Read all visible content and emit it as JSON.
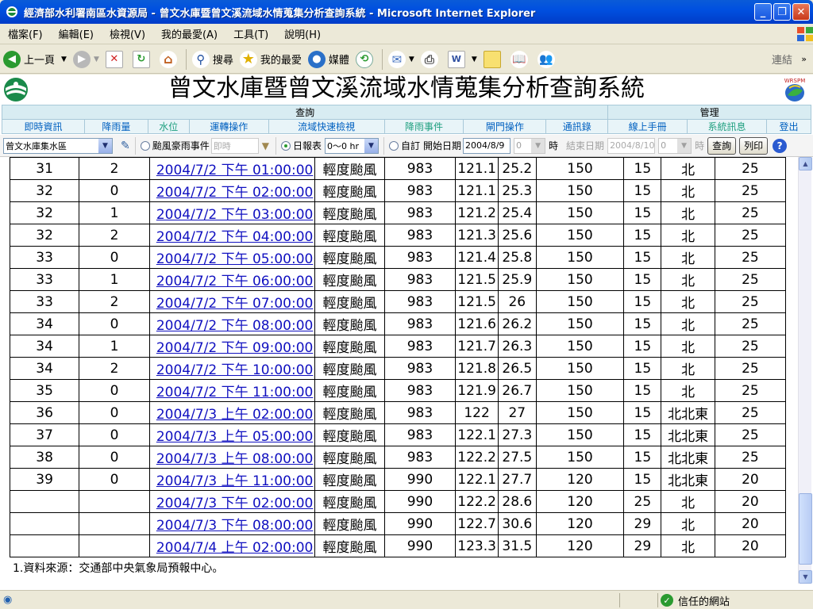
{
  "window": {
    "title": "經濟部水利署南區水資源局 - 曾文水庫暨曾文溪流域水情蒐集分析查詢系統 - Microsoft Internet Explorer"
  },
  "menu": [
    "檔案(F)",
    "編輯(E)",
    "檢視(V)",
    "我的最愛(A)",
    "工具(T)",
    "說明(H)"
  ],
  "toolbar": {
    "back": "上一頁",
    "search": "搜尋",
    "favorites": "我的最愛",
    "media": "媒體",
    "links": "連結"
  },
  "page": {
    "title": "曾文水庫暨曾文溪流域水情蒐集分析查詢系統",
    "logo_right_text": "WRSPM"
  },
  "nav": {
    "categories": [
      "查詢",
      "管理"
    ],
    "items": [
      "即時資訊",
      "降雨量",
      "水位",
      "運轉操作",
      "流域快速檢視",
      "降雨事件",
      "閘門操作",
      "通訊錄",
      "線上手冊",
      "系統訊息",
      "登出"
    ]
  },
  "filters": {
    "area": "曾文水庫集水區",
    "typhoon_label": "颱風豪雨事件",
    "typhoon_value": "即時",
    "daily_label": "日報表",
    "daily_value": "0～0 hr",
    "custom_label": "自訂",
    "start_label": "開始日期",
    "start_date": "2004/8/9",
    "start_hour": "0",
    "hour_unit": "時",
    "end_label": "結束日期",
    "end_date": "2004/8/10",
    "end_hour": "0",
    "query_button": "查詢",
    "print_button": "列印"
  },
  "table": {
    "rows": [
      [
        "31",
        "2",
        "2004/7/2 下午 01:00:00",
        "輕度颱風",
        "983",
        "121.1",
        "25.2",
        "150",
        "15",
        "北",
        "25"
      ],
      [
        "32",
        "0",
        "2004/7/2 下午 02:00:00",
        "輕度颱風",
        "983",
        "121.1",
        "25.3",
        "150",
        "15",
        "北",
        "25"
      ],
      [
        "32",
        "1",
        "2004/7/2 下午 03:00:00",
        "輕度颱風",
        "983",
        "121.2",
        "25.4",
        "150",
        "15",
        "北",
        "25"
      ],
      [
        "32",
        "2",
        "2004/7/2 下午 04:00:00",
        "輕度颱風",
        "983",
        "121.3",
        "25.6",
        "150",
        "15",
        "北",
        "25"
      ],
      [
        "33",
        "0",
        "2004/7/2 下午 05:00:00",
        "輕度颱風",
        "983",
        "121.4",
        "25.8",
        "150",
        "15",
        "北",
        "25"
      ],
      [
        "33",
        "1",
        "2004/7/2 下午 06:00:00",
        "輕度颱風",
        "983",
        "121.5",
        "25.9",
        "150",
        "15",
        "北",
        "25"
      ],
      [
        "33",
        "2",
        "2004/7/2 下午 07:00:00",
        "輕度颱風",
        "983",
        "121.5",
        "26",
        "150",
        "15",
        "北",
        "25"
      ],
      [
        "34",
        "0",
        "2004/7/2 下午 08:00:00",
        "輕度颱風",
        "983",
        "121.6",
        "26.2",
        "150",
        "15",
        "北",
        "25"
      ],
      [
        "34",
        "1",
        "2004/7/2 下午 09:00:00",
        "輕度颱風",
        "983",
        "121.7",
        "26.3",
        "150",
        "15",
        "北",
        "25"
      ],
      [
        "34",
        "2",
        "2004/7/2 下午 10:00:00",
        "輕度颱風",
        "983",
        "121.8",
        "26.5",
        "150",
        "15",
        "北",
        "25"
      ],
      [
        "35",
        "0",
        "2004/7/2 下午 11:00:00",
        "輕度颱風",
        "983",
        "121.9",
        "26.7",
        "150",
        "15",
        "北",
        "25"
      ],
      [
        "36",
        "0",
        "2004/7/3 上午 02:00:00",
        "輕度颱風",
        "983",
        "122",
        "27",
        "150",
        "15",
        "北北東",
        "25"
      ],
      [
        "37",
        "0",
        "2004/7/3 上午 05:00:00",
        "輕度颱風",
        "983",
        "122.1",
        "27.3",
        "150",
        "15",
        "北北東",
        "25"
      ],
      [
        "38",
        "0",
        "2004/7/3 上午 08:00:00",
        "輕度颱風",
        "983",
        "122.2",
        "27.5",
        "150",
        "15",
        "北北東",
        "25"
      ],
      [
        "39",
        "0",
        "2004/7/3 上午 11:00:00",
        "輕度颱風",
        "990",
        "122.1",
        "27.7",
        "120",
        "15",
        "北北東",
        "20"
      ],
      [
        "",
        "",
        "2004/7/3 下午 02:00:00",
        "輕度颱風",
        "990",
        "122.2",
        "28.6",
        "120",
        "25",
        "北",
        "20"
      ],
      [
        "",
        "",
        "2004/7/3 下午 08:00:00",
        "輕度颱風",
        "990",
        "122.7",
        "30.6",
        "120",
        "29",
        "北",
        "20"
      ],
      [
        "",
        "",
        "2004/7/4 上午 02:00:00",
        "輕度颱風",
        "990",
        "123.3",
        "31.5",
        "120",
        "29",
        "北",
        "20"
      ]
    ],
    "note": "1.資料來源：交通部中央氣象局預報中心。"
  },
  "status": {
    "zone": "信任的網站"
  }
}
